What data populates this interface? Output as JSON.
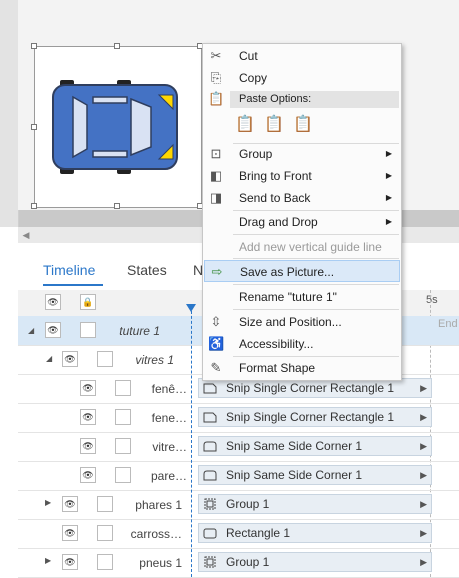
{
  "tabs": [
    {
      "label": "Timeline"
    },
    {
      "label": "States"
    },
    {
      "label": "N"
    }
  ],
  "timeline": {
    "time_marker": "5s",
    "end_label": "End",
    "layers": [
      {
        "name": "tuture 1",
        "bar": ""
      },
      {
        "name": "vitres 1",
        "bar": ""
      },
      {
        "name": "fenê…",
        "bar": "Snip Single Corner Rectangle 1"
      },
      {
        "name": "fene…",
        "bar": "Snip Single Corner Rectangle 1"
      },
      {
        "name": "vitre…",
        "bar": "Snip Same Side Corner 1"
      },
      {
        "name": "pare…",
        "bar": "Snip Same Side Corner 1"
      },
      {
        "name": "phares 1",
        "bar": "Group 1"
      },
      {
        "name": "carross…",
        "bar": "Rectangle 1"
      },
      {
        "name": "pneus 1",
        "bar": "Group 1"
      }
    ]
  },
  "context_menu": {
    "cut": "Cut",
    "copy": "Copy",
    "paste_options": "Paste Options:",
    "group": "Group",
    "bring_to_front": "Bring to Front",
    "send_to_back": "Send to Back",
    "drag_and_drop": "Drag and Drop",
    "add_guide": "Add new vertical guide line",
    "save_as_picture": "Save as Picture...",
    "rename": "Rename \"tuture 1\"",
    "size_position": "Size and Position...",
    "accessibility": "Accessibility...",
    "format_shape": "Format Shape"
  },
  "colors": {
    "accent": "#2b77c9",
    "car_body": "#4472c4",
    "car_window": "#d9e2f3",
    "car_light": "#ffd700",
    "selection": "#d9e8f6"
  }
}
